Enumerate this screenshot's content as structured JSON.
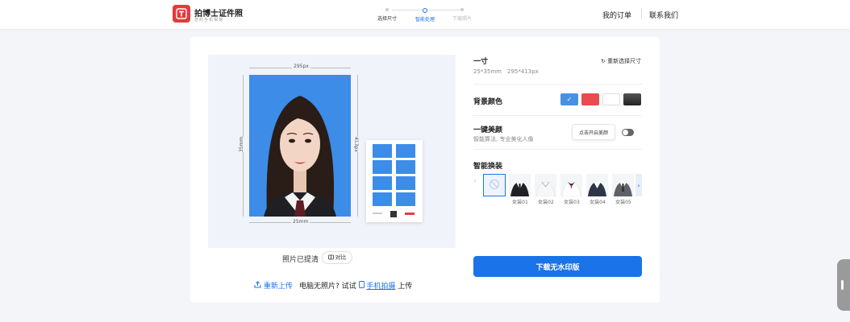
{
  "header": {
    "logo_title": "拍博士证件照",
    "logo_sub": "您的手机相馆",
    "steps": [
      {
        "label": "选择尺寸",
        "state": "done"
      },
      {
        "label": "智能处理",
        "state": "active"
      },
      {
        "label": "下载照片",
        "state": "pending"
      }
    ],
    "nav": {
      "orders": "我的订单",
      "contact": "联系我们"
    }
  },
  "photo": {
    "width_px": "295px",
    "height_px": "413px",
    "width_mm": "25mm",
    "height_mm": "35mm",
    "clear_text": "照片已提清",
    "compare_label": "对比"
  },
  "upload": {
    "reupload": "重新上传",
    "no_photo_text": "电脑无照片? 试试",
    "phone_link": "手机拍摄",
    "upload_suffix": "上传"
  },
  "size": {
    "name": "一寸",
    "mm": "25*35mm",
    "px": "295*413px",
    "reselect": "重新选择尺寸"
  },
  "background": {
    "title": "背景颜色",
    "colors": [
      "#4a90e2",
      "#e84c4c",
      "#ffffff",
      "#3a3a3a"
    ],
    "selected_check": "✓"
  },
  "beauty": {
    "title": "一键美颜",
    "subtitle": "智能算法, 专业美化人像",
    "tip": "点击开启美颜"
  },
  "outfit": {
    "title": "智能换装",
    "items": [
      "女装01",
      "女装02",
      "女装03",
      "女装04",
      "女装05"
    ]
  },
  "download_label": "下载无水印版",
  "colors": {
    "accent": "#1a73e8",
    "photo_bg": "#3d8ce8",
    "brand": "#e53a3a"
  }
}
